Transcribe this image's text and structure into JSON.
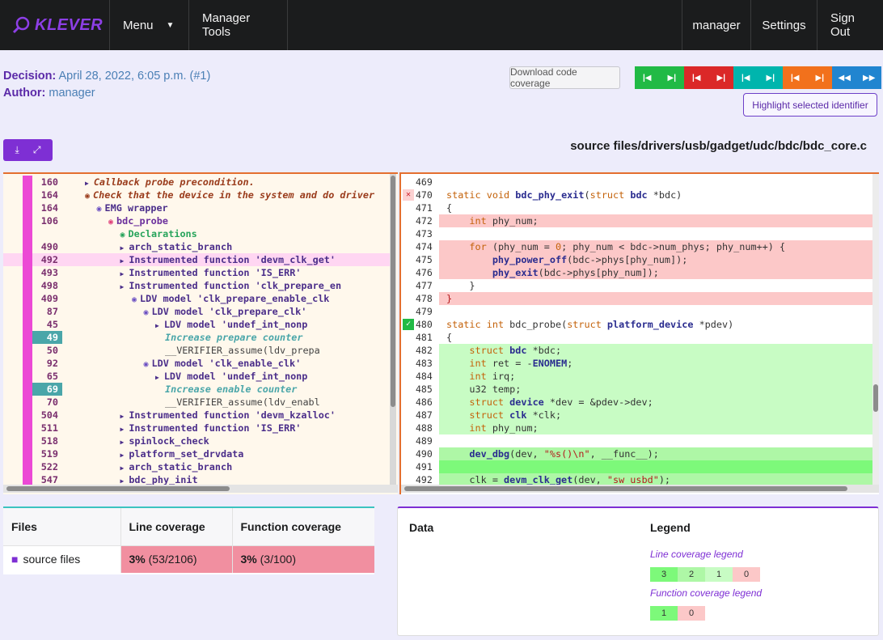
{
  "nav": {
    "brand": "KLEVER",
    "menu": "Menu",
    "manager_tools": "Manager Tools",
    "user": "manager",
    "settings": "Settings",
    "sign_out": "Sign Out"
  },
  "header": {
    "decision_label": "Decision:",
    "decision_value": "April 28, 2022, 6:05 p.m. (#1)",
    "author_label": "Author:",
    "author_value": "manager",
    "download_coverage": "Download code coverage",
    "highlight_identifier": "Highlight selected identifier",
    "source_path": "source files/drivers/usb/gadget/udc/bdc/bdc_core.c"
  },
  "nav_buttons": [
    {
      "color": "#21ba45",
      "icon": "first-icon"
    },
    {
      "color": "#21ba45",
      "icon": "last-icon"
    },
    {
      "color": "#db2828",
      "icon": "first-icon"
    },
    {
      "color": "#db2828",
      "icon": "last-icon"
    },
    {
      "color": "#00b5ad",
      "icon": "first-icon"
    },
    {
      "color": "#00b5ad",
      "icon": "last-icon"
    },
    {
      "color": "#f2711c",
      "icon": "first-icon"
    },
    {
      "color": "#f2711c",
      "icon": "last-icon"
    },
    {
      "color": "#2185d0",
      "icon": "fast-backward-icon"
    },
    {
      "color": "#2185d0",
      "icon": "fast-forward-icon"
    }
  ],
  "trace": [
    {
      "line": "160",
      "indent": 0,
      "style": "note",
      "marker": "tri",
      "text": "Callback probe precondition."
    },
    {
      "line": "164",
      "indent": 0,
      "style": "note",
      "marker": "eye",
      "text": "Check that the device in the system and do driver"
    },
    {
      "line": "164",
      "indent": 1,
      "style": "normal",
      "marker": "eye",
      "text": "EMG wrapper"
    },
    {
      "line": "106",
      "indent": 2,
      "style": "bdc",
      "marker": "eye-red",
      "text": "bdc_probe"
    },
    {
      "line": "",
      "indent": 3,
      "style": "decl",
      "marker": "eye",
      "text": "Declarations"
    },
    {
      "line": "490",
      "indent": 3,
      "style": "normal",
      "marker": "tri",
      "text": "arch_static_branch"
    },
    {
      "line": "492",
      "indent": 3,
      "style": "normal",
      "marker": "tri",
      "text": "Instrumented function 'devm_clk_get'",
      "highlight": true
    },
    {
      "line": "493",
      "indent": 3,
      "style": "normal",
      "marker": "tri",
      "text": "Instrumented function 'IS_ERR'"
    },
    {
      "line": "498",
      "indent": 3,
      "style": "normal",
      "marker": "tri",
      "text": "Instrumented function 'clk_prepare_en"
    },
    {
      "line": "409",
      "indent": 4,
      "style": "normal",
      "marker": "eye",
      "text": "LDV model 'clk_prepare_enable_clk"
    },
    {
      "line": "87",
      "indent": 5,
      "style": "normal",
      "marker": "eye",
      "text": "LDV model 'clk_prepare_clk'"
    },
    {
      "line": "45",
      "indent": 6,
      "style": "normal",
      "marker": "tri",
      "text": "LDV model 'undef_int_nonp"
    },
    {
      "line": "49",
      "indent": 6,
      "style": "info",
      "marker": "",
      "text": "Increase prepare counter",
      "lncolor": "#4aa6a9"
    },
    {
      "line": "50",
      "indent": 6,
      "style": "plain",
      "marker": "",
      "text": "__VERIFIER_assume(ldv_prepa"
    },
    {
      "line": "92",
      "indent": 5,
      "style": "normal",
      "marker": "eye",
      "text": "LDV model 'clk_enable_clk'"
    },
    {
      "line": "65",
      "indent": 6,
      "style": "normal",
      "marker": "tri",
      "text": "LDV model 'undef_int_nonp"
    },
    {
      "line": "69",
      "indent": 6,
      "style": "info",
      "marker": "",
      "text": "Increase enable counter",
      "lncolor": "#4aa6a9"
    },
    {
      "line": "70",
      "indent": 6,
      "style": "plain",
      "marker": "",
      "text": "__VERIFIER_assume(ldv_enabl"
    },
    {
      "line": "504",
      "indent": 3,
      "style": "normal",
      "marker": "tri",
      "text": "Instrumented function 'devm_kzalloc'"
    },
    {
      "line": "511",
      "indent": 3,
      "style": "normal",
      "marker": "tri",
      "text": "Instrumented function 'IS_ERR'"
    },
    {
      "line": "518",
      "indent": 3,
      "style": "normal",
      "marker": "tri",
      "text": "spinlock_check"
    },
    {
      "line": "519",
      "indent": 3,
      "style": "normal",
      "marker": "tri",
      "text": "platform_set_drvdata"
    },
    {
      "line": "522",
      "indent": 3,
      "style": "normal",
      "marker": "tri",
      "text": "arch_static_branch"
    },
    {
      "line": "547",
      "indent": 3,
      "style": "normal",
      "marker": "tri",
      "text": "bdc_phy_init"
    }
  ],
  "code": [
    {
      "line": "469",
      "bg": "",
      "mark": "",
      "text": ""
    },
    {
      "line": "470",
      "bg": "",
      "mark": "x",
      "html": "<span class='kw'>static</span> <span class='kw'>void</span> <span class='fn'>bdc_phy_exit</span>(<span class='kw'>struct</span> <span class='ty'>bdc</span> *bdc)"
    },
    {
      "line": "471",
      "bg": "",
      "mark": "",
      "text": "{"
    },
    {
      "line": "472",
      "bg": "#fcc8c8",
      "mark": "",
      "html": "    <span class='kw'>int</span> phy_num;"
    },
    {
      "line": "473",
      "bg": "",
      "mark": "",
      "text": ""
    },
    {
      "line": "474",
      "bg": "#fcc8c8",
      "mark": "",
      "html": "    <span class='kw'>for</span> (phy_num = <span class='num'>0</span>; phy_num &lt; bdc-&gt;num_phys; phy_num++) {"
    },
    {
      "line": "475",
      "bg": "#fcc8c8",
      "mark": "",
      "html": "        <span class='fn'>phy_power_off</span>(bdc-&gt;phys[phy_num]);"
    },
    {
      "line": "476",
      "bg": "#fcc8c8",
      "mark": "",
      "html": "        <span class='fn'>phy_exit</span>(bdc-&gt;phys[phy_num]);"
    },
    {
      "line": "477",
      "bg": "",
      "mark": "",
      "text": "    }"
    },
    {
      "line": "478",
      "bg": "#fcc8c8",
      "mark": "",
      "html": "<span class='str'>}</span>"
    },
    {
      "line": "479",
      "bg": "",
      "mark": "",
      "text": ""
    },
    {
      "line": "480",
      "bg": "",
      "mark": "check",
      "html": "<span class='kw'>static</span> <span class='kw'>int</span> bdc_probe(<span class='kw'>struct</span> <span class='ty'>platform_device</span> *pdev)"
    },
    {
      "line": "481",
      "bg": "",
      "mark": "",
      "text": "{"
    },
    {
      "line": "482",
      "bg": "#c8fcc4",
      "mark": "",
      "html": "    <span class='kw'>struct</span> <span class='ty'>bdc</span> *bdc;"
    },
    {
      "line": "483",
      "bg": "#c8fcc4",
      "mark": "",
      "html": "    <span class='kw'>int</span> ret = -<span class='ty'>ENOMEM</span>;"
    },
    {
      "line": "484",
      "bg": "#c8fcc4",
      "mark": "",
      "html": "    <span class='kw'>int</span> irq;"
    },
    {
      "line": "485",
      "bg": "#c8fcc4",
      "mark": "",
      "html": "    u32 temp;"
    },
    {
      "line": "486",
      "bg": "#c8fcc4",
      "mark": "",
      "html": "    <span class='kw'>struct</span> <span class='ty'>device</span> *dev = &amp;pdev-&gt;dev;"
    },
    {
      "line": "487",
      "bg": "#c8fcc4",
      "mark": "",
      "html": "    <span class='kw'>struct</span> <span class='ty'>clk</span> *clk;"
    },
    {
      "line": "488",
      "bg": "#c8fcc4",
      "mark": "",
      "html": "    <span class='kw'>int</span> phy_num;"
    },
    {
      "line": "489",
      "bg": "",
      "mark": "",
      "text": ""
    },
    {
      "line": "490",
      "bg": "#aef7a6",
      "mark": "",
      "html": "    <span class='fn'>dev_dbg</span>(dev, <span class='str'>\"%s()\\n\"</span>, __func__);"
    },
    {
      "line": "491",
      "bg": "#7df97a",
      "mark": "",
      "text": ""
    },
    {
      "line": "492",
      "bg": "#aef7a6",
      "mark": "",
      "html": "    clk = <span class='fn'>devm_clk_get</span>(dev, <span class='str'>\"sw_usbd\"</span>);"
    }
  ],
  "files_table": {
    "headers": [
      "Files",
      "Line coverage",
      "Function coverage"
    ],
    "row": {
      "name": "source files",
      "line_pct": "3%",
      "line_detail": " (53/2106)",
      "func_pct": "3%",
      "func_detail": " (3/100)"
    }
  },
  "data_panel": {
    "data_title": "Data",
    "legend_title": "Legend",
    "line_legend_title": "Line coverage legend",
    "line_legend": [
      {
        "label": "3",
        "color": "#7df97a"
      },
      {
        "label": "2",
        "color": "#aef7a6"
      },
      {
        "label": "1",
        "color": "#c8fcc4"
      },
      {
        "label": "0",
        "color": "#fcc8c8"
      }
    ],
    "func_legend_title": "Function coverage legend",
    "func_legend": [
      {
        "label": "1",
        "color": "#7df97a"
      },
      {
        "label": "0",
        "color": "#fcc8c8"
      }
    ]
  }
}
